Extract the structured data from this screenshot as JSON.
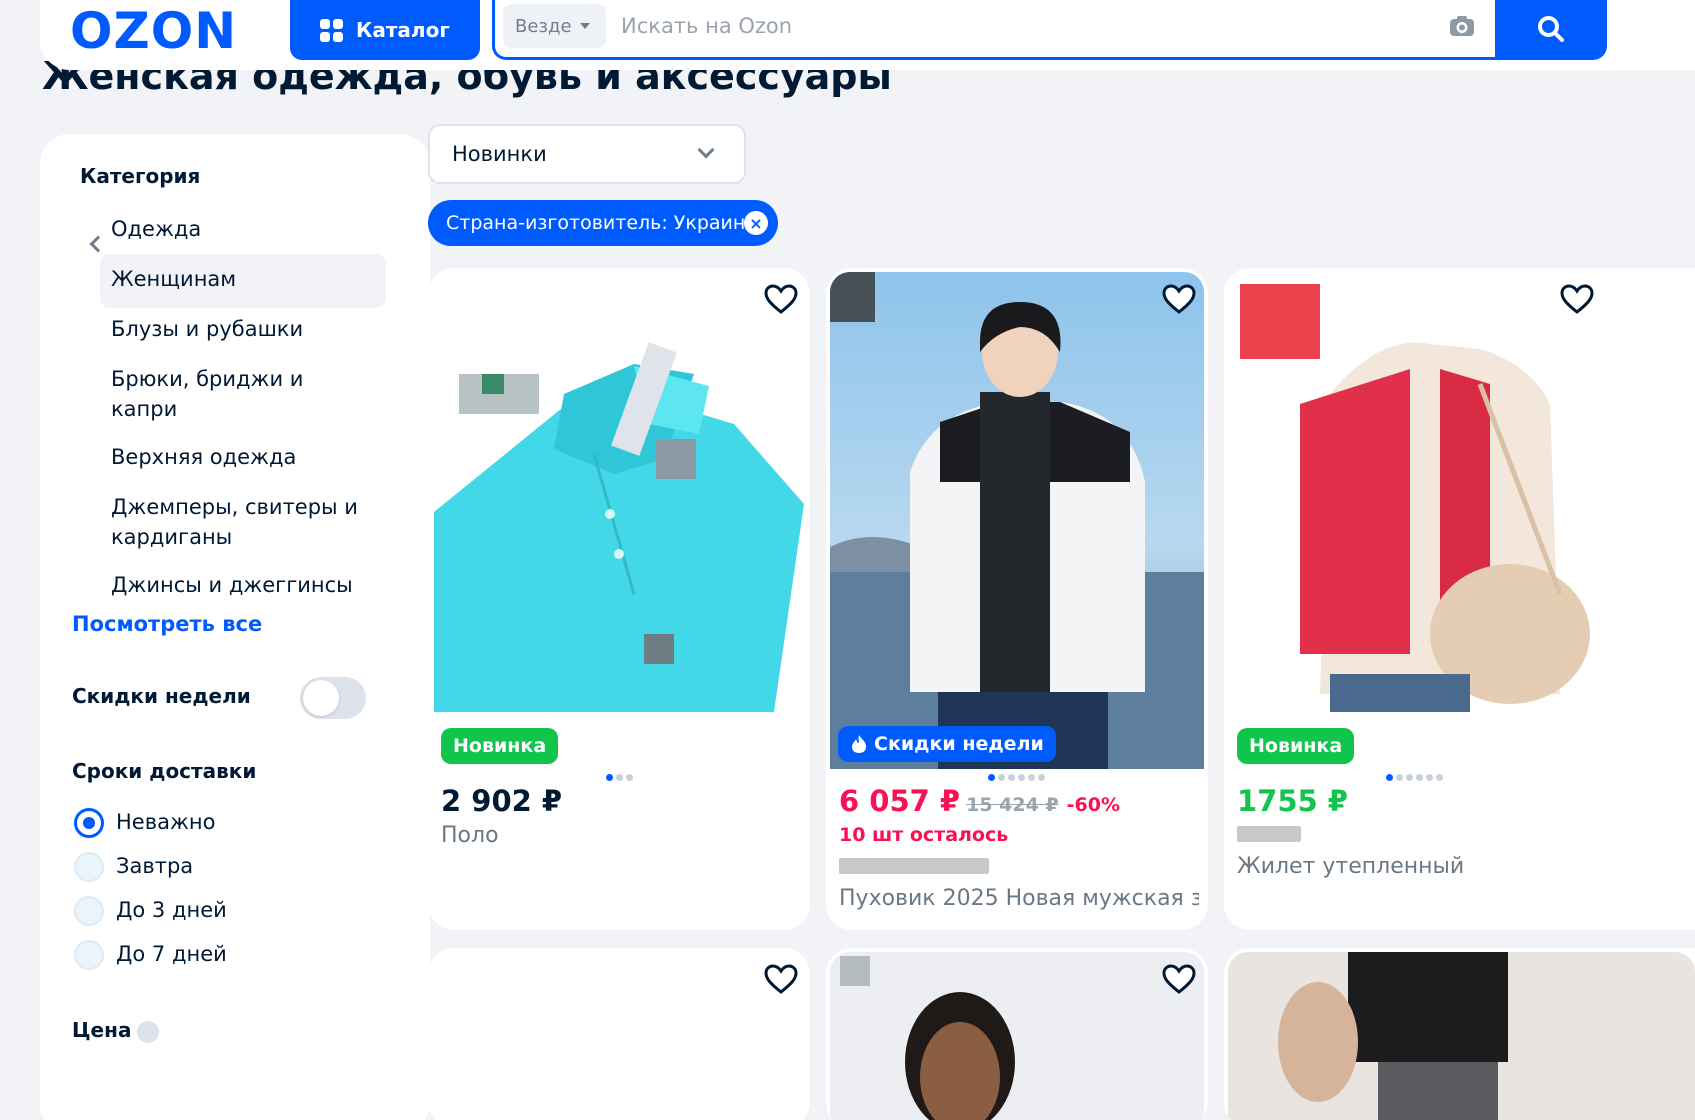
{
  "header": {
    "logo": "OZON",
    "catalog_label": "Каталог",
    "search_scope": "Везде",
    "search_placeholder": "Искать на Ozon"
  },
  "page_title": "Женская одежда, обувь и аксессуары",
  "sidebar": {
    "category_heading": "Категория",
    "parent_category": "Одежда",
    "items": [
      {
        "label": "Женщинам",
        "active": true
      },
      {
        "label": "Блузы и рубашки"
      },
      {
        "label": "Брюки, бриджи и капри"
      },
      {
        "label": "Верхняя одежда"
      },
      {
        "label": "Джемперы, свитеры и кардиганы"
      },
      {
        "label": "Джинсы и джеггинсы"
      }
    ],
    "see_all": "Посмотреть все",
    "weekly_discounts_label": "Скидки недели",
    "weekly_discounts_on": false,
    "delivery_heading": "Сроки доставки",
    "delivery_options": [
      {
        "label": "Неважно",
        "checked": true
      },
      {
        "label": "Завтра"
      },
      {
        "label": "До 3 дней"
      },
      {
        "label": "До 7 дней"
      }
    ],
    "price_heading": "Цена"
  },
  "sort": {
    "value": "Новинки"
  },
  "active_filter": "Страна-изготовитель: Украина",
  "products": [
    {
      "badge": "Новинка",
      "price": "2 902 ₽",
      "name": "Поло",
      "dots": 3,
      "active_dot": 0
    },
    {
      "badge": "Скидки недели",
      "price": "6 057 ₽",
      "old_price": "15 424 ₽",
      "discount": "-60%",
      "stock": "10 шт осталось",
      "name": "Пуховик 2025 Новая мужская з...",
      "dots": 6,
      "active_dot": 0
    },
    {
      "badge": "Новинка",
      "price": "1755 ₽",
      "name": "Жилет утепленный",
      "dots": 6,
      "active_dot": 0
    }
  ],
  "colors": {
    "brand": "#005bff",
    "sale_price": "#f91155",
    "new_price": "#10c44c",
    "badge_green": "#10c44c"
  }
}
